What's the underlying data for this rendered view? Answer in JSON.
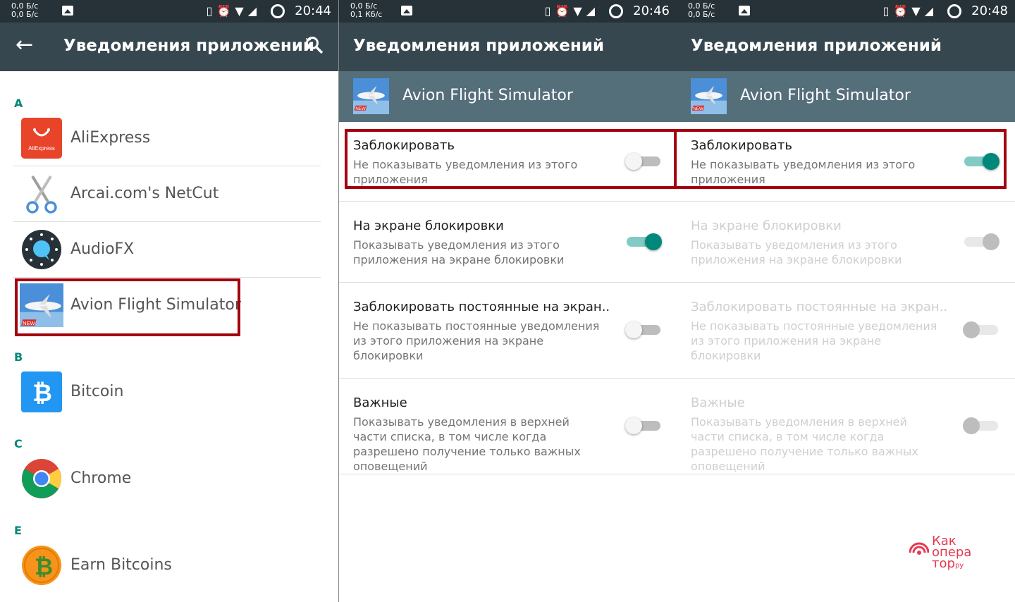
{
  "panels": [
    {
      "status": {
        "net1": "0,0 Б/с",
        "net2": "0,0 Б/с",
        "time": "20:44"
      },
      "title": "Уведомления приложений"
    },
    {
      "status": {
        "net1": "0,0 Б/с",
        "net2": "0,1 Кб/с",
        "time": "20:46"
      },
      "title": "Уведомления приложений"
    },
    {
      "status": {
        "net1": "0,0 Б/с",
        "net2": "0,0 Б/с",
        "time": "20:48"
      },
      "title": "Уведомления приложений"
    }
  ],
  "app_list": {
    "sections": [
      {
        "letter": "A",
        "apps": [
          "AliExpress",
          "Arcai.com's NetCut",
          "AudioFX",
          "Avion Flight Simulator"
        ]
      },
      {
        "letter": "B",
        "apps": [
          "Bitcoin"
        ]
      },
      {
        "letter": "C",
        "apps": [
          "Chrome"
        ]
      },
      {
        "letter": "E",
        "apps": [
          "Earn Bitcoins"
        ]
      }
    ],
    "aliexpress_icon_text": "AliExpress"
  },
  "app_detail": {
    "app_name": "Avion Flight Simulator",
    "icon_badge": "NEW",
    "settings": [
      {
        "title": "Заблокировать",
        "desc": "Не показывать уведомления из этого приложения"
      },
      {
        "title": "На экране блокировки",
        "desc": "Показывать уведомления из этого приложения на экране блокировки"
      },
      {
        "title": "Заблокировать постоянные на экран..",
        "desc": "Не показывать постоянные уведомления из этого приложения на экране блокировки"
      },
      {
        "title": "Важные",
        "desc": "Показывать уведомления в верхней части списка, в том числе когда разрешено получение только важных оповещений"
      }
    ],
    "panel2_switches": [
      false,
      true,
      false,
      false
    ],
    "panel3_switches": [
      true,
      true,
      false,
      false
    ],
    "panel3_disabled": [
      false,
      true,
      true,
      true
    ]
  },
  "watermark": {
    "line1": "Как",
    "line2": "опера",
    "line3": "тор",
    "suffix": "ру"
  },
  "colors": {
    "statusbar": "#263238",
    "appbar": "#37474f",
    "header": "#546e7a",
    "accent": "#00897b",
    "highlight": "#a4000f"
  }
}
